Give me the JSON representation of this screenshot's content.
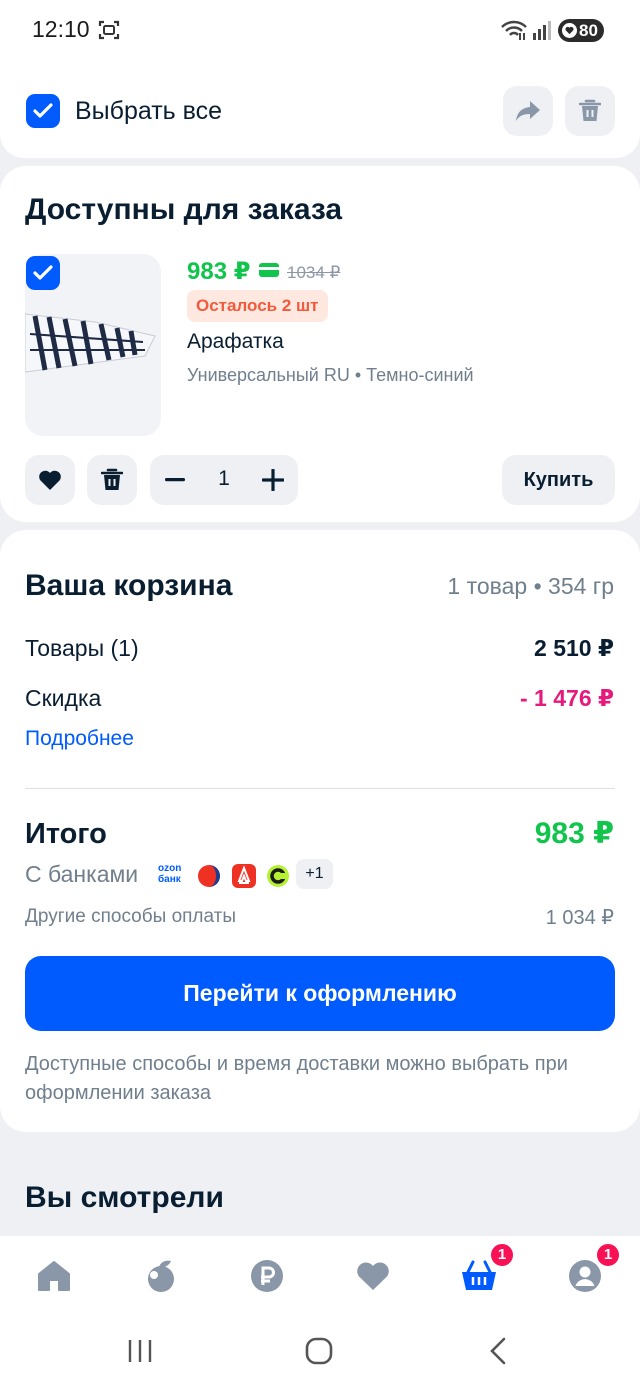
{
  "status_bar": {
    "time": "12:10",
    "battery": "80"
  },
  "select_all": {
    "label": "Выбрать все",
    "checked": true,
    "icons": [
      "share-icon",
      "trash-icon"
    ]
  },
  "available": {
    "title": "Доступны для заказа",
    "item": {
      "price": "983 ₽",
      "old_price": "1034 ₽",
      "stock": "Осталось 2 шт",
      "name": "Арафатка",
      "meta": "Универсальный RU • Темно-синий",
      "quantity": "1",
      "buy_label": "Купить"
    }
  },
  "cart": {
    "title": "Ваша корзина",
    "meta": "1 товар • 354 гр",
    "goods_label": "Товары (1)",
    "goods_value": "2 510 ₽",
    "discount_label": "Скидка",
    "discount_value": "- 1 476 ₽",
    "details_link": "Подробнее",
    "total_label": "Итого",
    "total_value": "983 ₽",
    "banks_label": "С банками",
    "ozon_bank_logo": "ozon\nбанк",
    "banks_more": "+1",
    "other_label": "Другие способы оплаты",
    "other_value": "1 034 ₽",
    "checkout_label": "Перейти к оформлению",
    "delivery_note": "Доступные способы и время доставки можно выбрать при оформлении заказа"
  },
  "viewed_title": "Вы смотрели",
  "bottom_nav": {
    "items": [
      "home-icon",
      "fresh-icon",
      "ruble-icon",
      "favorites-icon",
      "cart-icon",
      "profile-icon"
    ],
    "cart_badge": "1",
    "profile_badge": "1"
  },
  "colors": {
    "accent": "#005bff",
    "price_green": "#10c44c",
    "discount_pink": "#e6197d",
    "badge": "#f91155"
  }
}
